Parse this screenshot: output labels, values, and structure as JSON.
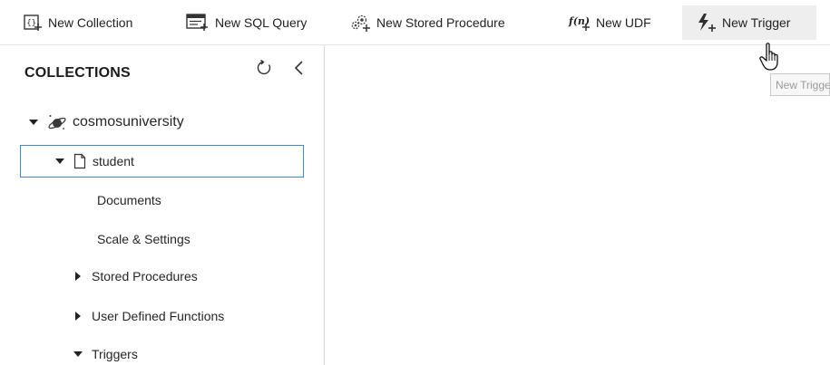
{
  "toolbar": {
    "new_collection": {
      "label": "New Collection",
      "icon": "new-collection-icon"
    },
    "new_sql_query": {
      "label": "New SQL Query",
      "icon": "new-sql-query-icon"
    },
    "new_stored_procedure": {
      "label": "New Stored Procedure",
      "icon": "new-stored-procedure-icon"
    },
    "new_udf": {
      "label": "New UDF",
      "icon": "new-udf-icon",
      "icon_text": "f(n)"
    },
    "new_trigger": {
      "label": "New Trigger",
      "icon": "new-trigger-icon",
      "hovered": true
    }
  },
  "tooltip": {
    "text": "New Trigger"
  },
  "collections_panel": {
    "title": "COLLECTIONS",
    "refresh_icon": "refresh-icon",
    "collapse_icon": "chevron-left-icon",
    "database": {
      "name": "cosmosuniversity",
      "expanded": true,
      "icon": "planet-icon"
    },
    "collection": {
      "name": "student",
      "expanded": true,
      "selected": true,
      "icon": "collection-icon",
      "children": [
        {
          "label": "Documents",
          "type": "leaf"
        },
        {
          "label": "Scale & Settings",
          "type": "leaf"
        },
        {
          "label": "Stored Procedures",
          "type": "expandable",
          "expanded": false
        },
        {
          "label": "User Defined Functions",
          "type": "expandable",
          "expanded": false
        },
        {
          "label": "Triggers",
          "type": "expandable",
          "expanded": true
        }
      ]
    }
  },
  "colors": {
    "selection_border": "#3c8ad6",
    "hover_background": "#eeeeee",
    "trigger_icon": "#2f2f2f"
  }
}
